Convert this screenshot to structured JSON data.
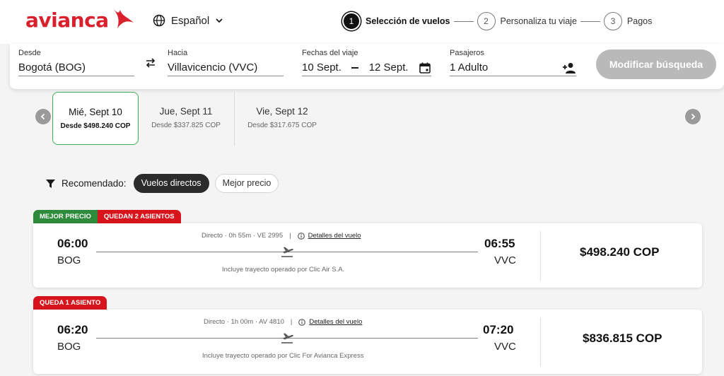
{
  "brand": {
    "name": "avianca",
    "color": "#d8212c"
  },
  "language": {
    "label": "Español",
    "icon": "globe-icon"
  },
  "steps": [
    {
      "number": "1",
      "label": "Selección de vuelos",
      "active": true
    },
    {
      "number": "2",
      "label": "Personaliza tu viaje",
      "active": false
    },
    {
      "number": "3",
      "label": "Pagos",
      "active": false
    }
  ],
  "search": {
    "from_label": "Desde",
    "from_value": "Bogotá (BOG)",
    "to_label": "Hacia",
    "to_value": "Villavicencio (VVC)",
    "dates_label": "Fechas del viaje",
    "date_from": "10 Sept.",
    "date_to": "12 Sept.",
    "pax_label": "Pasajeros",
    "pax_value": "1 Adulto",
    "modify_button": "Modificar búsqueda"
  },
  "date_tabs": [
    {
      "title": "Mié, Sept 10",
      "price": "Desde $498.240 COP",
      "selected": true
    },
    {
      "title": "Jue, Sept 11",
      "price": "Desde $337.825 COP",
      "selected": false
    },
    {
      "title": "Vie, Sept 12",
      "price": "Desde $317.675 COP",
      "selected": false
    }
  ],
  "filter": {
    "label": "Recomendado:",
    "options": [
      {
        "label": "Vuelos directos",
        "selected": true
      },
      {
        "label": "Mejor precio",
        "selected": false
      }
    ]
  },
  "flights": [
    {
      "badges": [
        "MEJOR PRECIO",
        "QUEDAN 2 ASIENTOS"
      ],
      "depart_time": "06:00",
      "depart_code": "BOG",
      "arrive_time": "06:55",
      "arrive_code": "VVC",
      "info": "Directo · 0h 55m · VE 2995",
      "details_link": "Detalles del vuelo",
      "operator": "Incluye trayecto operado por Clic Air S.A.",
      "price": "$498.240 COP"
    },
    {
      "badges": [
        "QUEDA 1 ASIENTO"
      ],
      "depart_time": "06:20",
      "depart_code": "BOG",
      "arrive_time": "07:20",
      "arrive_code": "VVC",
      "info": "Directo · 1h 00m · AV 4810",
      "details_link": "Detalles del vuelo",
      "operator": "Incluye trayecto operado por Clic For Avianca Express",
      "price": "$836.815 COP"
    }
  ],
  "colors": {
    "best_price": "#2e8b3c",
    "seats_left": "#d7131c",
    "selected_tab_border": "#3fae5f",
    "disabled_button": "#b9b9b9"
  }
}
